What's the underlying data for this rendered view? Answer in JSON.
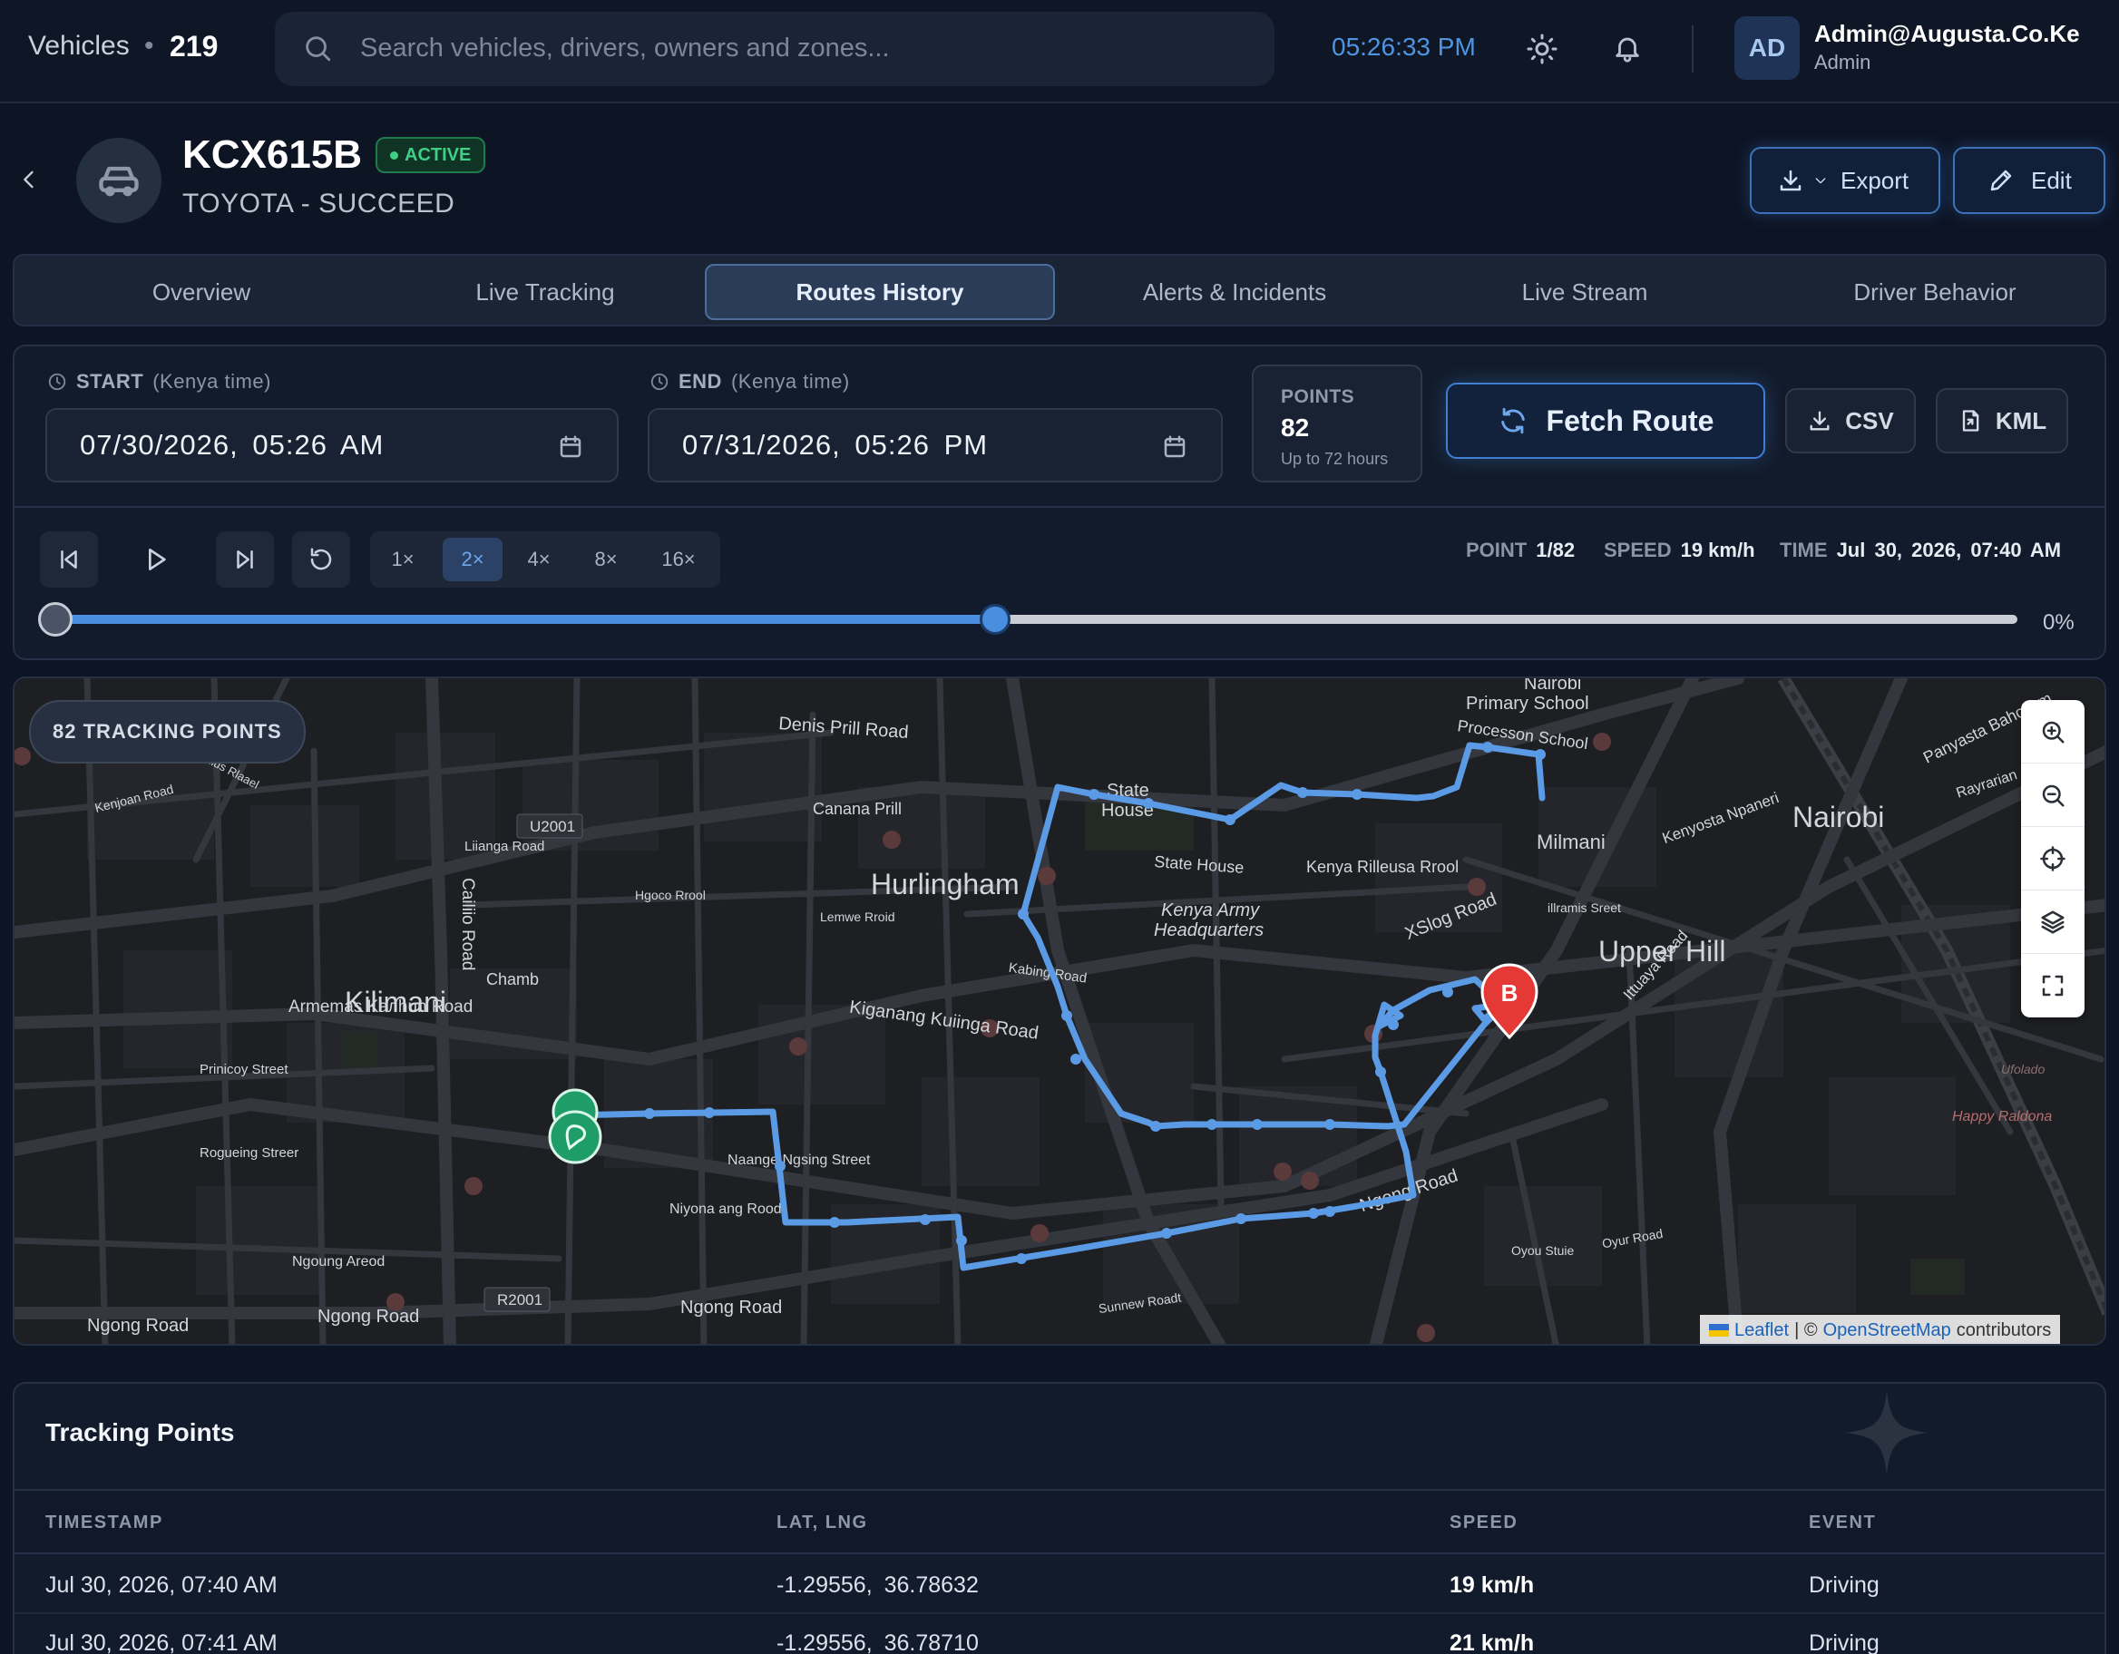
{
  "topbar": {
    "vehicles_label": "Vehicles",
    "vehicles_count": "219",
    "search_placeholder": "Search vehicles, drivers, owners and zones...",
    "clock": "05:26:33 PM",
    "user_initials": "AD",
    "user_name": "Admin@Augusta.Co.Ke",
    "user_role": "Admin",
    "icons": [
      "search-icon",
      "sun-icon",
      "bell-icon"
    ]
  },
  "vehicle": {
    "plate": "KCX615B",
    "status": "ACTIVE",
    "model": "TOYOTA - SUCCEED",
    "export_label": "Export",
    "edit_label": "Edit"
  },
  "tabs": [
    {
      "label": "Overview",
      "active": false
    },
    {
      "label": "Live Tracking",
      "active": false
    },
    {
      "label": "Routes History",
      "active": true
    },
    {
      "label": "Alerts & Incidents",
      "active": false
    },
    {
      "label": "Live Stream",
      "active": false
    },
    {
      "label": "Driver Behavior",
      "active": false
    }
  ],
  "controls": {
    "start_label": "START",
    "start_sub": "(Kenya time)",
    "start_value": "07/30/2026, 05:26 AM",
    "end_label": "END",
    "end_sub": "(Kenya time)",
    "end_value": "07/31/2026, 05:26 PM",
    "points_label": "POINTS",
    "points_value": "82",
    "points_note": "Up to 72 hours",
    "fetch_label": "Fetch Route",
    "csv_label": "CSV",
    "kml_label": "KML"
  },
  "playback": {
    "speeds": [
      "1×",
      "2×",
      "4×",
      "8×",
      "16×"
    ],
    "active_speed": "2×",
    "point_key": "POINT",
    "point_value": "1/82",
    "speed_key": "SPEED",
    "speed_value": "19 km/h",
    "time_key": "TIME",
    "time_value": "Jul 30, 2026, 07:40 AM",
    "progress_text": "0%",
    "buffered_fraction": 0.48
  },
  "map": {
    "tracking_points_pill": "82 TRACKING POINTS",
    "end_marker": "B",
    "labels": {
      "hurlingham": "Hurlingham",
      "kilimani": "Kilimani",
      "upper_hill": "Upper Hill",
      "nairobi": "Nairobi",
      "milmani": "Milmani",
      "state_house_1": "State",
      "state_house_2": "House",
      "state_house_road": "State House",
      "kenya_army_1": "Kenya Army",
      "kenya_army_2": "Headquarters",
      "nairobi_primary_1": "Nairobi",
      "nairobi_primary_2": "Primary School",
      "processon_school": "Processon School",
      "denis_prill": "Denis Prill Road",
      "canana_prill": "Canana Prill",
      "kenya_rilleusa": "Kenya Rilleusa Rrool",
      "armemas": "Armemas Kaлhun Road",
      "kiganang": "Kiganang Kuiinga Road",
      "ngong_1": "Ngong Road",
      "ngong_2": "Ngong Road",
      "ngong_3": "Ngong Road",
      "ngong_4": "Ngong Road",
      "niyona": "Niyona ang Rood",
      "naange": "Naange Ngsing Street",
      "liianga": "Liianga Road",
      "cailiio": "Cailiio Road",
      "ngoung": "Ngoung Areod",
      "princoy": "Prinicoy Street",
      "rogueing": "Rogueing Streer",
      "kenjoan": "Kenjoan Road",
      "xslog": "XSlog Road",
      "kenyosta": "Kenyosta Npaneri",
      "panyasta": "Panyasta Bahoijam",
      "rayrarian": "Rayrarian",
      "ittuaya": "Ittuaya Road",
      "illramis": "illramis Sreet",
      "kabing": "Kabing Road",
      "hgoco": "Hgoco Rrool",
      "lemwe": "Lemwe Rroid",
      "chamb": "Chamb",
      "sunnew": "Sunnew Roadt",
      "oyou": "Oyou Stuie",
      "oyur": "Oyur Road",
      "u2001": "U2001",
      "r2001": "R2001",
      "mondiius": "Mondiius Rlaael",
      "happy": "Happy Raldona",
      "ufolado": "Ufolado"
    },
    "attribution_leaflet": "Leaflet",
    "attribution_sep": "| ©",
    "attribution_osm": "OpenStreetMap",
    "attribution_rest": "contributors"
  },
  "tracking": {
    "title": "Tracking Points",
    "columns": [
      "TIMESTAMP",
      "LAT, LNG",
      "SPEED",
      "EVENT"
    ],
    "rows": [
      {
        "timestamp": "Jul 30, 2026, 07:40 AM",
        "latlng": "-1.29556, 36.78632",
        "speed": "19 km/h",
        "event": "Driving"
      },
      {
        "timestamp": "Jul 30, 2026, 07:41 AM",
        "latlng": "-1.29556, 36.78710",
        "speed": "21 km/h",
        "event": "Driving"
      }
    ]
  },
  "colors": {
    "route": "#5b9be6",
    "accent": "#4a8ee0",
    "active_green": "#3fcf85",
    "end_marker": "#e53935",
    "start_marker": "#1f9d68"
  }
}
